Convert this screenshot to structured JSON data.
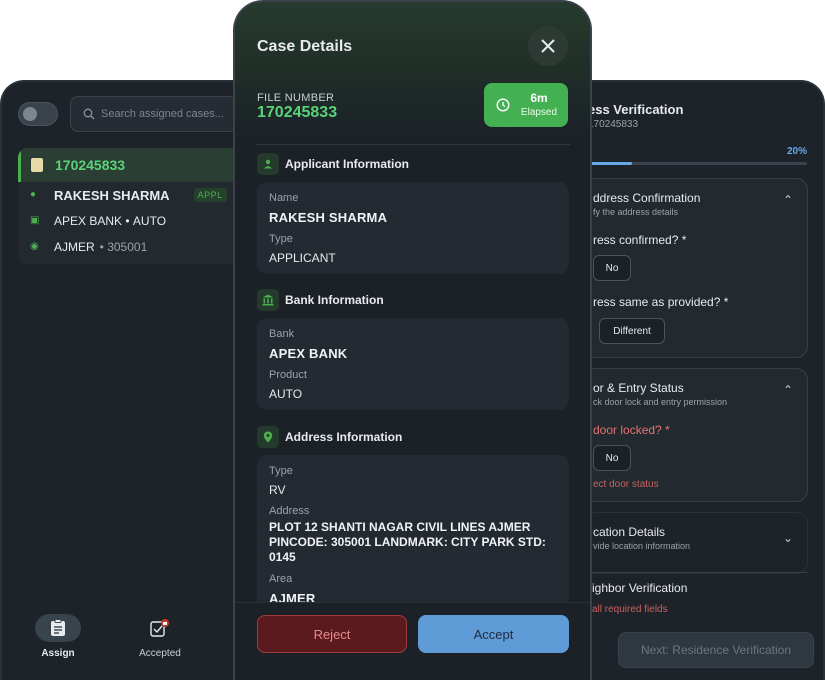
{
  "left_screen": {
    "search": {
      "placeholder": "Search assigned cases..."
    },
    "case": {
      "file_number": "170245833",
      "name": "RAKESH SHARMA",
      "badge": "APPL",
      "bank": "APEX BANK",
      "product_sep": " • ",
      "product": "AUTO",
      "city": "AJMER",
      "pincode": "• 305001"
    },
    "tabs": [
      {
        "label": "Assign",
        "active": true
      },
      {
        "label": "Accepted",
        "active": false
      }
    ]
  },
  "modal": {
    "title": "Case Details",
    "file_number_label": "FILE NUMBER",
    "file_number": "170245833",
    "elapsed_value": "6m",
    "elapsed_label": "Elapsed",
    "applicant": {
      "heading": "Applicant Information",
      "name_label": "Name",
      "name": "RAKESH SHARMA",
      "type_label": "Type",
      "type": "APPLICANT"
    },
    "bank": {
      "heading": "Bank Information",
      "bank_label": "Bank",
      "bank": "APEX BANK",
      "product_label": "Product",
      "product": "AUTO"
    },
    "address": {
      "heading": "Address Information",
      "type_label": "Type",
      "type": "RV",
      "address_label": "Address",
      "address": "PLOT 12 SHANTI NAGAR CIVIL LINES AJMER PINCODE: 305001 LANDMARK: CITY PARK STD: 0145",
      "area_label": "Area",
      "area": "AJMER"
    },
    "reject_label": "Reject",
    "accept_label": "Accept"
  },
  "right_screen": {
    "title": "ess Verification",
    "subtitle": "170245833",
    "progress_label": "20%",
    "progress": 0.2,
    "sections": {
      "address": {
        "title": "ddress Confirmation",
        "subtitle": "fy the address details",
        "q1": "ress confirmed? *",
        "q1_option": "No",
        "q2": "ress same as provided? *",
        "q2_option": "Different"
      },
      "door": {
        "title": "or & Entry Status",
        "subtitle": "ck door lock and entry permission",
        "q1": "door locked? *",
        "q1_option": "No",
        "error": "ect door status"
      },
      "location": {
        "title": "cation Details",
        "subtitle": "vide location information"
      },
      "neighbor": {
        "title": "ighbor Verification"
      }
    },
    "warning": "all required fields",
    "next_label": "Next: Residence Verification"
  },
  "colors": {
    "accent_green": "#4caf50",
    "elapsed_green": "#43b052",
    "accept_blue": "#5f9bd6",
    "reject_red": "#5a1a1e",
    "error_red": "#e57373",
    "progress_blue": "#66a8e8"
  }
}
